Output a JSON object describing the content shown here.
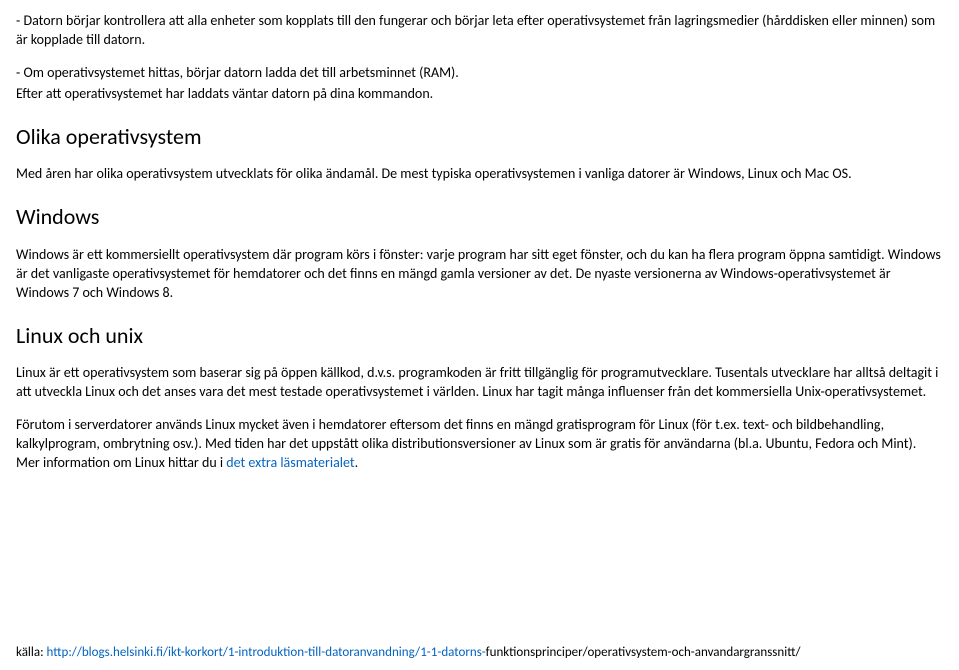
{
  "intro": {
    "p1": "- Datorn börjar kontrollera att alla enheter som kopplats till den fungerar och börjar leta efter operativsystemet från lagringsmedier (hårddisken eller minnen) som är kopplade till datorn.",
    "p2": "- Om operativsystemet hittas, börjar datorn ladda det till arbetsminnet (RAM).",
    "p3": "Efter att operativsystemet har laddats väntar datorn på dina kommandon."
  },
  "sections": {
    "olika": {
      "heading": "Olika operativsystem",
      "p1": "Med åren har olika operativsystem utvecklats för olika ändamål. De mest typiska operativsystemen i vanliga datorer är Windows, Linux och Mac OS."
    },
    "windows": {
      "heading": "Windows",
      "p1": "Windows är ett kommersiellt operativsystem där program körs i fönster: varje program har sitt eget fönster, och du kan ha flera program öppna samtidigt. Windows är det vanligaste operativsystemet för hemdatorer och det finns en mängd gamla versioner av det. De nyaste versionerna av Windows-operativsystemet är Windows 7 och Windows 8."
    },
    "linux": {
      "heading": "Linux och unix",
      "p1": "Linux är ett operativsystem som baserar sig på öppen källkod, d.v.s. programkoden är fritt tillgänglig för programutvecklare. Tusentals utvecklare har alltså deltagit i att utveckla Linux och det anses vara det mest testade operativsystemet i världen. Linux har tagit många influenser från det kommersiella Unix-operativsystemet.",
      "p2_part1": "Förutom i serverdatorer används Linux mycket även i hemdatorer eftersom det finns en mängd gratisprogram för Linux (för t.ex. text- och bildbehandling, kalkylprogram, ombrytning osv.). Med tiden har det uppstått olika distributionsversioner av Linux som är gratis för användarna (bl.a. Ubuntu, Fedora och Mint). Mer information om Linux hittar du i ",
      "p2_link": "det extra läsmaterialet",
      "p2_part2": "."
    }
  },
  "footer": {
    "label": "källa: ",
    "link": "http://blogs.helsinki.fi/ikt-korkort/1-introduktion-till-datoranvandning/1-1-datorns-",
    "rest": "funktionsprinciper/operativsystem-och-anvandargranssnitt/"
  }
}
